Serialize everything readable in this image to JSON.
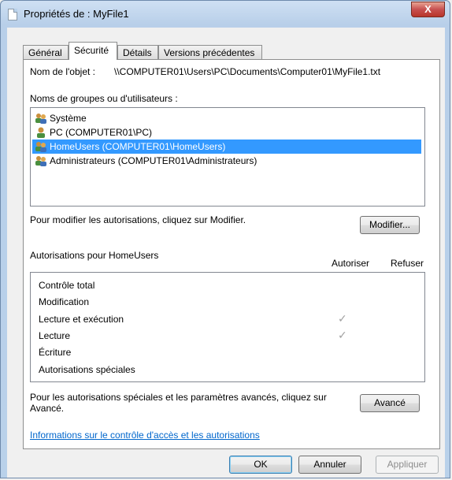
{
  "window": {
    "title": "Propriétés de : MyFile1",
    "close_label": "X"
  },
  "tabs": [
    {
      "label": "Général"
    },
    {
      "label": "Sécurité"
    },
    {
      "label": "Détails"
    },
    {
      "label": "Versions précédentes"
    }
  ],
  "object": {
    "label": "Nom de l'objet :",
    "value": "\\\\COMPUTER01\\Users\\PC\\Documents\\Computer01\\MyFile1.txt"
  },
  "groups": {
    "label": "Noms de groupes ou d'utilisateurs :",
    "items": [
      {
        "label": "Système",
        "icon": "group-icon"
      },
      {
        "label": "PC (COMPUTER01\\PC)",
        "icon": "user-icon"
      },
      {
        "label": "HomeUsers (COMPUTER01\\HomeUsers)",
        "icon": "group-icon"
      },
      {
        "label": "Administrateurs (COMPUTER01\\Administrateurs)",
        "icon": "group-icon"
      }
    ],
    "selected_index": 2
  },
  "modify": {
    "hint": "Pour modifier les autorisations, cliquez sur Modifier.",
    "button": "Modifier..."
  },
  "permissions": {
    "title": "Autorisations pour HomeUsers",
    "allow_header": "Autoriser",
    "deny_header": "Refuser",
    "rows": [
      {
        "label": "Contrôle total",
        "allow": false,
        "deny": false
      },
      {
        "label": "Modification",
        "allow": false,
        "deny": false
      },
      {
        "label": "Lecture et exécution",
        "allow": true,
        "deny": false
      },
      {
        "label": "Lecture",
        "allow": true,
        "deny": false
      },
      {
        "label": "Écriture",
        "allow": false,
        "deny": false
      },
      {
        "label": "Autorisations spéciales",
        "allow": false,
        "deny": false
      }
    ],
    "check_glyph": "✓"
  },
  "advanced": {
    "hint_line1": "Pour les autorisations spéciales et les paramètres avancés, cliquez sur",
    "hint_line2": "Avancé.",
    "button": "Avancé"
  },
  "info_link": "Informations sur le contrôle d'accès et les autorisations",
  "footer": {
    "ok": "OK",
    "cancel": "Annuler",
    "apply": "Appliquer"
  }
}
